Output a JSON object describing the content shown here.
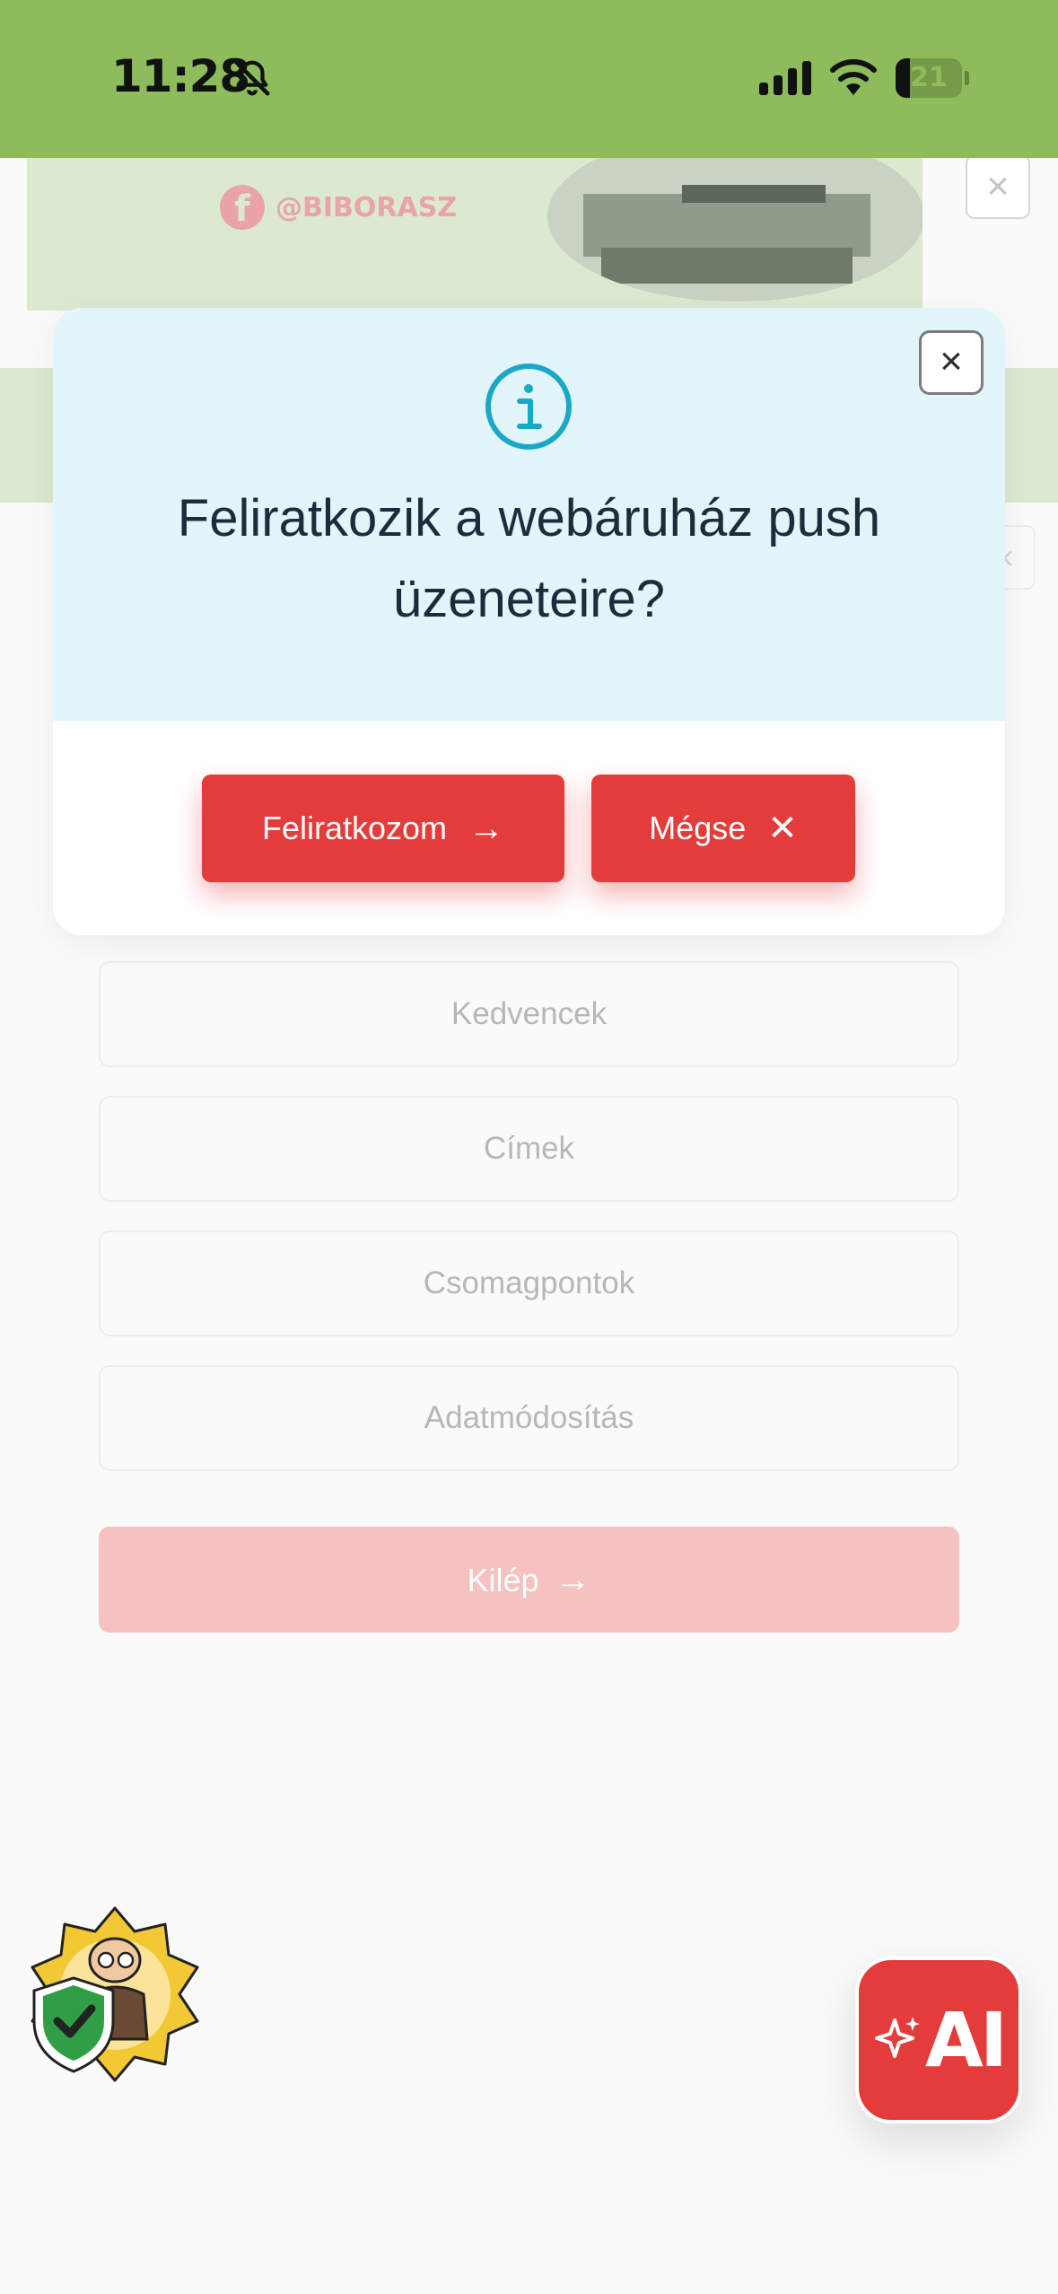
{
  "status_bar": {
    "time": "11:28",
    "battery": "21",
    "battery_level": 0.21
  },
  "banner": {
    "facebook_handle": "@BIBORASZ"
  },
  "modal": {
    "title": "Feliratkozik a webáruház push üzeneteire?",
    "subscribe_label": "Feliratkozom",
    "cancel_label": "Mégse"
  },
  "menu": {
    "items": [
      "Kedvencek",
      "Címek",
      "Csomagpontok",
      "Adatmódosítás"
    ],
    "logout_label": "Kilép"
  },
  "ai_button": {
    "label": "AI"
  },
  "colors": {
    "status_bar": "#8fbc5a",
    "accent_red": "#e43b3b",
    "modal_header": "#e1f5fb",
    "info_icon": "#1ba8c7"
  }
}
